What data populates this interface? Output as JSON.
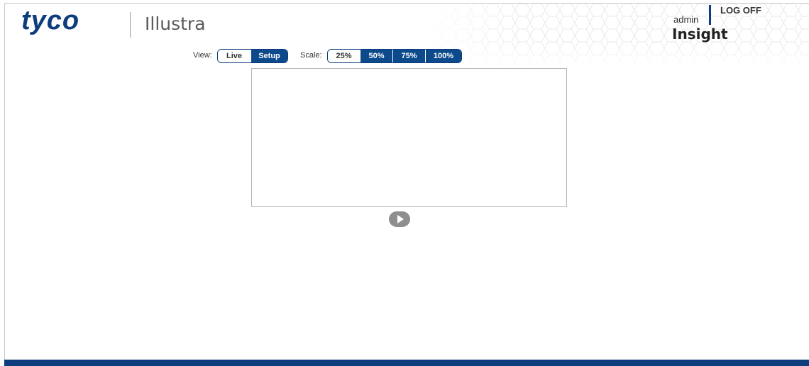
{
  "header": {
    "brand": "tyco",
    "product": "Illustra",
    "user": "admin",
    "logoff_label": "LOG OFF",
    "app_name": "Insight"
  },
  "controls": {
    "view_label": "View:",
    "view_options": [
      "Live",
      "Setup"
    ],
    "view_selected": "Setup",
    "scale_label": "Scale:",
    "scale_options": [
      "25%",
      "50%",
      "75%",
      "100%"
    ],
    "scale_selected": "25%"
  },
  "player": {
    "play_icon": "play-icon"
  },
  "colors": {
    "brand_blue": "#0d3d7c",
    "button_blue": "#0d4a8c"
  }
}
